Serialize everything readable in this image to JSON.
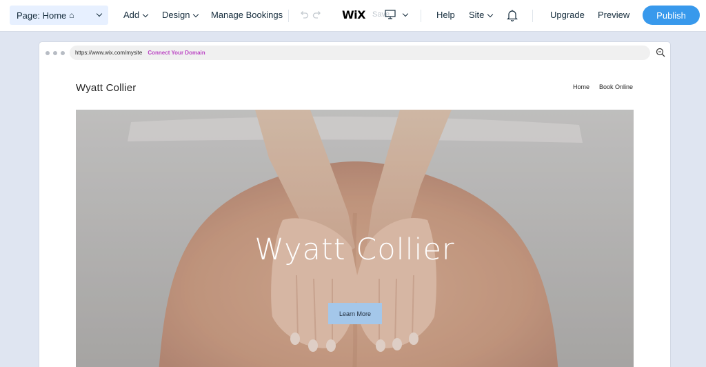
{
  "editor": {
    "page_select": "Page: Home",
    "menu": {
      "add": "Add",
      "design": "Design",
      "manage_bookings": "Manage Bookings",
      "help": "Help",
      "site": "Site",
      "upgrade": "Upgrade",
      "preview": "Preview",
      "publish": "Publish"
    },
    "logo": "WiX",
    "save_status": "Save",
    "icons": [
      "home-icon",
      "undo-icon",
      "redo-icon",
      "desktop-icon",
      "bell-icon",
      "zoom-icon"
    ]
  },
  "browser": {
    "url": "https://www.wix.com/mysite",
    "connect_link": "Connect Your Domain"
  },
  "site": {
    "header_title": "Wyatt Collier",
    "nav": [
      "Home",
      "Book Online"
    ],
    "hero_title": "Wyatt Collier",
    "hero_button": "Learn More"
  },
  "colors": {
    "publish": "#3899ec",
    "page_select_bg": "#e7f0ff",
    "canvas_bg": "#dfe5f1",
    "connect_link": "#bb46c4",
    "hero_button": "#a4c7ea"
  }
}
